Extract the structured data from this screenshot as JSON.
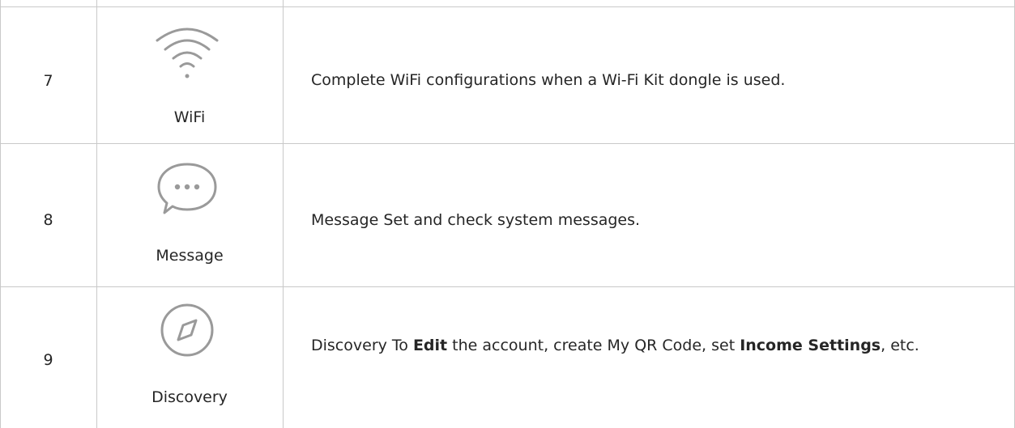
{
  "rows": [
    {
      "number": "7",
      "icon": "wifi-icon",
      "icon_label": "WiFi",
      "description": "Complete WiFi configurations when a Wi-Fi Kit dongle is used."
    },
    {
      "number": "8",
      "icon": "message-bubble-icon",
      "icon_label": "Message",
      "description": "Message Set and check system messages."
    },
    {
      "number": "9",
      "icon": "compass-icon",
      "icon_label": "Discovery",
      "description_parts": {
        "p1": "Discovery To ",
        "b1": "Edit",
        "p2": " the account, create My QR Code, set ",
        "b2": "Income Settings",
        "p3": ", etc."
      }
    }
  ],
  "colors": {
    "border": "#c9c9c9",
    "icon": "#9a9a9a",
    "text": "#262626"
  }
}
